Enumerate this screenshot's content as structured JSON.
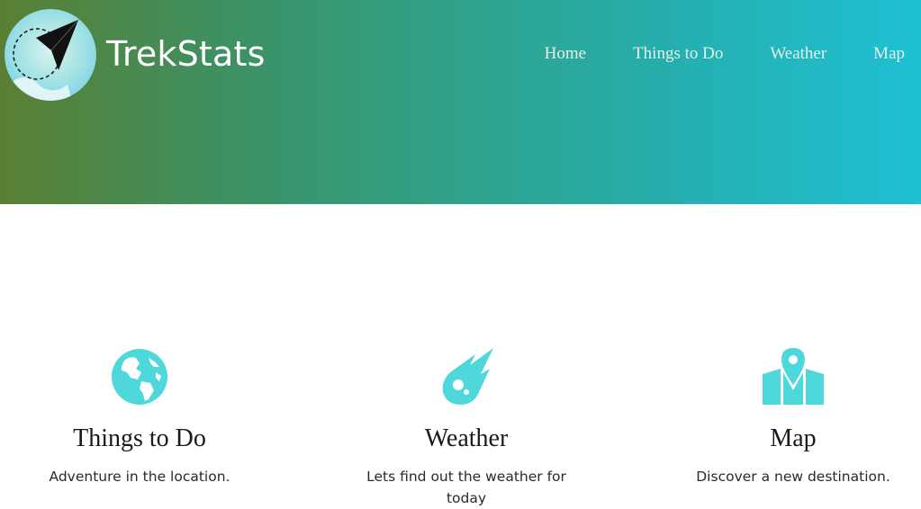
{
  "header": {
    "brand": "TrekStats",
    "logo_icon": "paper-plane-icon",
    "gradient_start": "#5a7f33",
    "gradient_end": "#1ec0d3"
  },
  "nav": {
    "items": [
      {
        "label": "Home"
      },
      {
        "label": "Things to Do"
      },
      {
        "label": "Weather"
      },
      {
        "label": "Map"
      }
    ]
  },
  "features": [
    {
      "icon": "globe-icon",
      "title": "Things to Do",
      "description": "Adventure in the location."
    },
    {
      "icon": "meteor-icon",
      "title": "Weather",
      "description": "Lets find out the weather for today"
    },
    {
      "icon": "map-pin-icon",
      "title": "Map",
      "description": "Discover a new destination."
    }
  ],
  "accent_color": "#4ed8dc"
}
